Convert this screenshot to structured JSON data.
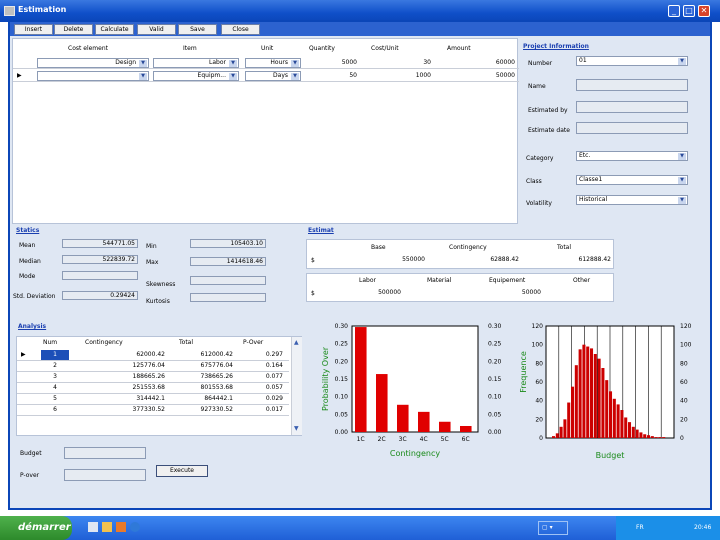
{
  "window": {
    "title": "Estimation",
    "min": "_",
    "max": "□",
    "close": "✕"
  },
  "toolbar": {
    "insert": "Insert",
    "delete": "Delete",
    "calculate": "Calculate",
    "valid": "Valid",
    "save": "Save",
    "close": "Close"
  },
  "cost_table": {
    "headers": [
      "Cost element",
      "Item",
      "Unit",
      "Quantity",
      "Cost/Unit",
      "Amount"
    ],
    "rows": [
      {
        "element": "Design",
        "item": "Labor",
        "unit": "Hours",
        "quantity": "5000",
        "cost_unit": "30",
        "amount": "60000"
      },
      {
        "element": "",
        "item": "Equipm...",
        "unit": "Days",
        "quantity": "50",
        "cost_unit": "1000",
        "amount": "50000"
      }
    ]
  },
  "project": {
    "title": "Project Information",
    "number_label": "Number",
    "number_value": "01",
    "name_label": "Name",
    "estimated_by_label": "Estimated by",
    "estimate_date_label": "Estimate date",
    "category_label": "Category",
    "category_value": "Etc.",
    "class_label": "Class",
    "class_value": "Classe1",
    "volatility_label": "Volatility",
    "volatility_value": "Historical"
  },
  "statics": {
    "title": "Statics",
    "mean_label": "Mean",
    "mean_value": "544771.05",
    "median_label": "Median",
    "median_value": "522839.72",
    "mode_label": "Mode",
    "mode_value": "",
    "std_label": "Std. Deviation",
    "std_value": "0.29424",
    "min_label": "Min",
    "min_value": "105403.10",
    "max_label": "Max",
    "max_value": "1414618.46",
    "skewness_label": "Skewness",
    "skewness_value": "",
    "kurtosis_label": "Kurtosis",
    "kurtosis_value": ""
  },
  "estimat": {
    "title": "Estimat",
    "currency": "$",
    "headers1": [
      "Base",
      "Contingency",
      "Total"
    ],
    "values1": [
      "550000",
      "62888.42",
      "612888.42"
    ],
    "headers2": [
      "Labor",
      "Material",
      "Equipement",
      "Other"
    ],
    "values2": [
      "500000",
      "",
      "50000",
      ""
    ]
  },
  "analysis": {
    "title": "Analysis",
    "headers": [
      "Num",
      "Contingency",
      "Total",
      "P-Over"
    ],
    "rows": [
      [
        "1",
        "62000.42",
        "612000.42",
        "0.297"
      ],
      [
        "2",
        "125776.04",
        "675776.04",
        "0.164"
      ],
      [
        "3",
        "188665.26",
        "738665.26",
        "0.077"
      ],
      [
        "4",
        "251553.68",
        "801553.68",
        "0.057"
      ],
      [
        "5",
        "314442.1",
        "864442.1",
        "0.029"
      ],
      [
        "6",
        "377330.52",
        "927330.52",
        "0.017"
      ]
    ],
    "budget_label": "Budget",
    "pover_label": "P-over",
    "execute_label": "Execute"
  },
  "chart_data": [
    {
      "type": "bar",
      "categories": [
        "1C",
        "2C",
        "3C",
        "4C",
        "5C",
        "6C"
      ],
      "values": [
        0.297,
        0.164,
        0.077,
        0.057,
        0.029,
        0.017
      ],
      "xlabel": "Contingency",
      "ylabel": "Probability Over",
      "ylim": [
        0,
        0.3
      ],
      "yticks": [
        "0.30",
        "0.25",
        "0.20",
        "0.15",
        "0.10",
        "0.05",
        "0.00"
      ],
      "color": "#e00000"
    },
    {
      "type": "bar",
      "xlabel": "Budget",
      "ylabel": "Frequence",
      "ylim": [
        0,
        120
      ],
      "yticks": [
        "120",
        "100",
        "80",
        "60",
        "40",
        "20",
        "0"
      ],
      "values": [
        2,
        5,
        12,
        20,
        38,
        55,
        78,
        95,
        100,
        98,
        96,
        90,
        85,
        75,
        62,
        50,
        42,
        36,
        30,
        22,
        17,
        12,
        9,
        6,
        4,
        3,
        2,
        1,
        1,
        1
      ],
      "color": "#cc0000"
    }
  ],
  "taskbar": {
    "start_label": "démarrer",
    "lang": "FR",
    "time": "20:46"
  }
}
